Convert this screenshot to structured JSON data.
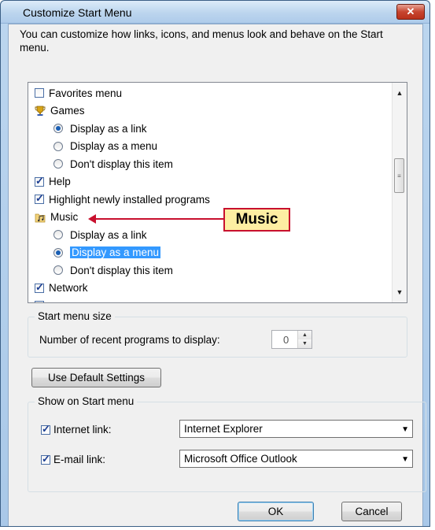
{
  "dialog": {
    "title": "Customize Start Menu",
    "close_glyph": "✕",
    "description": "You can customize how links, icons, and menus look and behave on the Start menu."
  },
  "options_list": {
    "items": [
      {
        "kind": "checkbox",
        "label": "Favorites menu",
        "checked": false
      },
      {
        "kind": "header",
        "label": "Games",
        "icon": "games-trophy-icon"
      },
      {
        "kind": "radio",
        "label": "Display as a link",
        "checked": true
      },
      {
        "kind": "radio",
        "label": "Display as a menu",
        "checked": false
      },
      {
        "kind": "radio",
        "label": "Don't display this item",
        "checked": false
      },
      {
        "kind": "checkbox",
        "label": "Help",
        "checked": true
      },
      {
        "kind": "checkbox",
        "label": "Highlight newly installed programs",
        "checked": true
      },
      {
        "kind": "header",
        "label": "Music",
        "icon": "music-folder-icon"
      },
      {
        "kind": "radio",
        "label": "Display as a link",
        "checked": false
      },
      {
        "kind": "radio",
        "label": "Display as a menu",
        "checked": true,
        "selected": true
      },
      {
        "kind": "radio",
        "label": "Don't display this item",
        "checked": false
      },
      {
        "kind": "checkbox",
        "label": "Network",
        "checked": true
      }
    ]
  },
  "start_menu_size": {
    "group_label": "Start menu size",
    "recent_programs_label": "Number of recent programs to display:",
    "recent_programs_value": "0"
  },
  "buttons": {
    "use_default": "Use Default Settings",
    "ok": "OK",
    "cancel": "Cancel"
  },
  "show_on_start": {
    "group_label": "Show on Start menu",
    "internet_link_label": "Internet link:",
    "internet_link_checked": true,
    "internet_link_value": "Internet Explorer",
    "email_link_label": "E-mail link:",
    "email_link_checked": true,
    "email_link_value": "Microsoft Office Outlook"
  },
  "callout": {
    "text": "Music"
  },
  "colors": {
    "selection": "#3399ff",
    "callout_border": "#c8102e",
    "callout_fill": "#fdeea2"
  }
}
